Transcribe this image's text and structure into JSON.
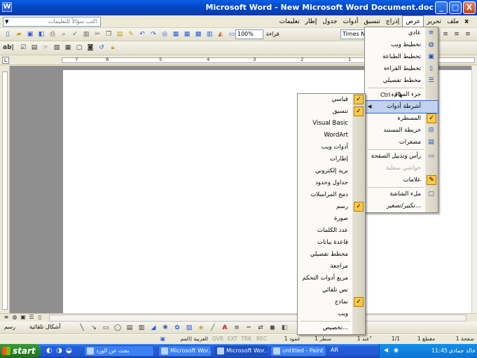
{
  "window": {
    "title": "Microsoft Word - New Microsoft Word Document.doc",
    "app_icon": "W",
    "minimize": "_",
    "maximize": "□",
    "close": "X"
  },
  "menubar": {
    "ask_placeholder": "اكتب سؤالاً للتعليمات",
    "items": [
      "ملف",
      "تحرير",
      "عرض",
      "إدراج",
      "تنسيق",
      "أدوات",
      "جدول",
      "إطار",
      "تعليمات"
    ],
    "close_x": "x"
  },
  "toolbar": {
    "zoom": "100%",
    "read": "قراءة",
    "font": "Times New Roman"
  },
  "ruler": {
    "numbers": [
      "7",
      "6",
      "5",
      "4",
      "3",
      "2",
      "1"
    ]
  },
  "view_menu": {
    "items": [
      {
        "label": "عادي",
        "icon": "normal-view-icon",
        "glyph": "≡",
        "type": "icon"
      },
      {
        "label": "تخطيط ويب",
        "icon": "web-layout-icon",
        "glyph": "◍",
        "type": "icon"
      },
      {
        "label": "تخطيط الطباعة",
        "icon": "print-layout-icon",
        "glyph": "▣",
        "type": "icon"
      },
      {
        "label": "تخطيط القراءة",
        "icon": "reading-layout-icon",
        "glyph": "▯",
        "type": "icon"
      },
      {
        "label": "مخطط تفصيلي",
        "icon": "outline-icon",
        "glyph": "☰",
        "type": "icon"
      },
      {
        "label": "جزء المهام",
        "shortcut": "Ctrl+F1",
        "type": "shortcut"
      },
      {
        "label": "أشرطة أدوات",
        "type": "submenu",
        "arrow": "◀"
      },
      {
        "label": "المسطرة",
        "type": "check",
        "glyph": "✓"
      },
      {
        "label": "خريطة المستند",
        "icon": "document-map-icon",
        "glyph": "⊟",
        "type": "icon"
      },
      {
        "label": "مصغرات",
        "icon": "thumbnails-icon",
        "glyph": "▤",
        "type": "icon"
      },
      {
        "label": "رأس وتذييل الصفحة",
        "icon": "header-footer-icon",
        "glyph": "▭",
        "type": "icon"
      },
      {
        "label": "حواشي سفلية",
        "type": "disabled"
      },
      {
        "label": "علامات",
        "icon": "markup-icon",
        "glyph": "✎",
        "type": "icon"
      },
      {
        "label": "ملء الشاشة",
        "icon": "full-screen-icon",
        "glyph": "▢",
        "type": "icon"
      },
      {
        "label": "تكبير/تصغير...",
        "type": "plain"
      }
    ]
  },
  "toolbars_menu": {
    "items": [
      {
        "label": "قياسي",
        "checked": true
      },
      {
        "label": "تنسيق",
        "checked": true
      },
      {
        "label": "Visual Basic",
        "checked": false
      },
      {
        "label": "WordArt",
        "checked": false
      },
      {
        "label": "أدوات ويب",
        "checked": false
      },
      {
        "label": "إطارات",
        "checked": false
      },
      {
        "label": "بريد إلكتروني",
        "checked": false
      },
      {
        "label": "جداول وحدود",
        "checked": false
      },
      {
        "label": "دمج المراسلات",
        "checked": false
      },
      {
        "label": "رسم",
        "checked": true
      },
      {
        "label": "صورة",
        "checked": false
      },
      {
        "label": "عدد الكلمات",
        "checked": false
      },
      {
        "label": "قاعدة بيانات",
        "checked": false
      },
      {
        "label": "مخطط تفصيلي",
        "checked": false
      },
      {
        "label": "مراجعة",
        "checked": false
      },
      {
        "label": "مربع أدوات التحكم",
        "checked": false
      },
      {
        "label": "نص تلقائي",
        "checked": false
      },
      {
        "label": "نماذج",
        "checked": true
      },
      {
        "label": "ويب",
        "checked": false
      },
      {
        "label": "تخصيص...",
        "checked": false,
        "separator_before": true
      }
    ],
    "check_glyph": "✓"
  },
  "drawbar": {
    "draw": "رسم",
    "autoshapes": "أشكال تلقائية"
  },
  "statusbar": {
    "page": "صفحة 1",
    "section": "مقطع 1",
    "pages": "1/1",
    "at": "عند 1\"",
    "line": "سطر 1",
    "col": "عمود 1",
    "rec": "REC",
    "trk": "TRK",
    "ext": "EXT",
    "ovr": "OVR",
    "language": "العربية (المم"
  },
  "taskbar": {
    "start": "start",
    "tasks": [
      {
        "label": "بحث عن الورد",
        "active": false
      },
      {
        "label": "Microsoft Wor...",
        "active": false
      },
      {
        "label": "Microsoft Wor...",
        "active": true
      },
      {
        "label": "untitled - Paint",
        "active": false
      }
    ],
    "lang": "AR",
    "clock": "11:45",
    "date": "خالد جمادى"
  }
}
